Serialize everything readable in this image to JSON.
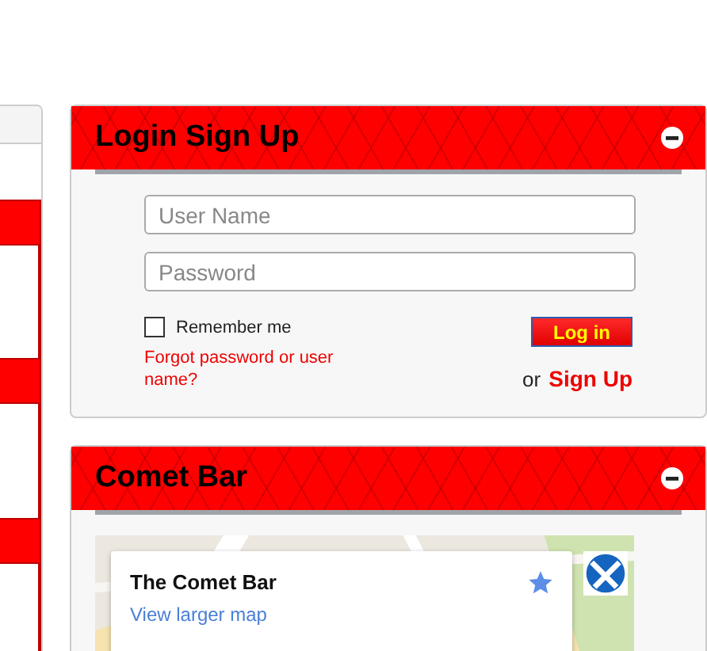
{
  "panels": [
    {
      "kind": "login",
      "title": "Login Sign Up",
      "expanded": true,
      "username": {
        "placeholder": "User Name"
      },
      "password": {
        "placeholder": "Password"
      },
      "remember": {
        "label": "Remember me",
        "checked": false
      },
      "forgot_link": "Forgot password or user name?",
      "login_button": "Log in",
      "or_text": "or",
      "signup_link": "Sign Up"
    },
    {
      "kind": "map",
      "title": "Comet Bar",
      "expanded": true,
      "map_card": {
        "title": "The Comet Bar",
        "link": "View larger map"
      }
    }
  ]
}
